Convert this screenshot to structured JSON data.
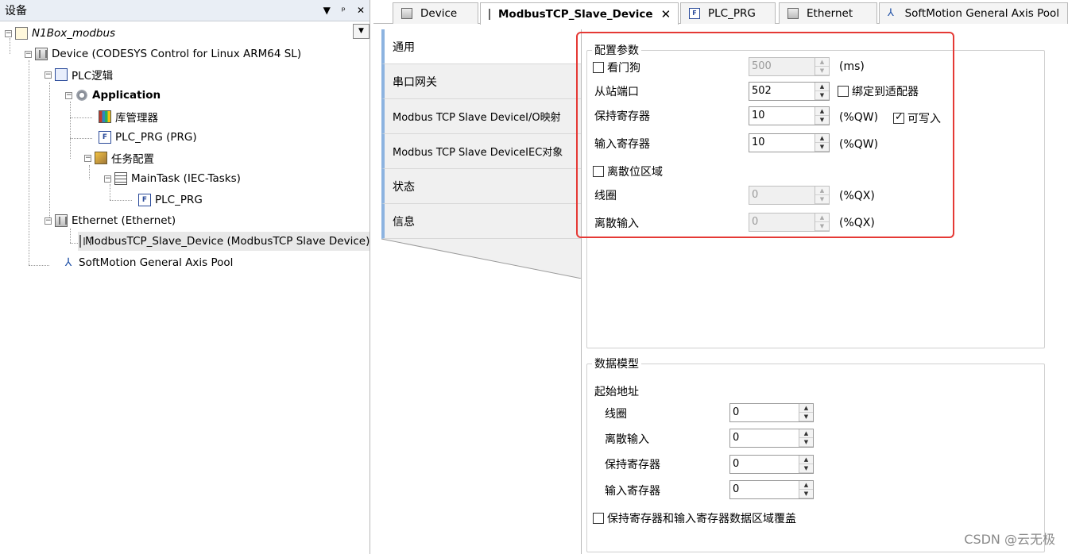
{
  "left_panel": {
    "title": "设备",
    "icons": [
      "▼",
      "ᵖ",
      "✕"
    ],
    "tree": [
      {
        "label": "N1Box_modbus",
        "icon": "project-icon"
      },
      {
        "label": "Device (CODESYS Control for Linux ARM64 SL)",
        "icon": "device-icon"
      },
      {
        "label": "PLC逻辑",
        "icon": "plc-logic-icon"
      },
      {
        "label": "Application",
        "icon": "application-gear-icon"
      },
      {
        "label": "库管理器",
        "icon": "library-manager-icon"
      },
      {
        "label": "PLC_PRG (PRG)",
        "icon": "prg-icon"
      },
      {
        "label": "任务配置",
        "icon": "task-config-icon"
      },
      {
        "label": "MainTask (IEC-Tasks)",
        "icon": "maintask-icon"
      },
      {
        "label": "PLC_PRG",
        "icon": "prg-icon"
      },
      {
        "label": "Ethernet (Ethernet)",
        "icon": "device-icon"
      },
      {
        "label": "ModbusTCP_Slave_Device (ModbusTCP Slave Device)",
        "icon": "device-icon"
      },
      {
        "label": "SoftMotion General Axis Pool",
        "icon": "axis-pool-icon"
      }
    ]
  },
  "tabs": [
    {
      "label": "Device",
      "icon": "device-icon"
    },
    {
      "label": "ModbusTCP_Slave_Device",
      "icon": "device-icon",
      "close": "✕"
    },
    {
      "label": "PLC_PRG",
      "icon": "prg-icon"
    },
    {
      "label": "Ethernet",
      "icon": "device-icon"
    },
    {
      "label": "SoftMotion General Axis Pool",
      "icon": "axis-pool-icon"
    }
  ],
  "sidenav": [
    "通用",
    "串口网关",
    "Modbus TCP Slave DeviceI/O映射",
    "Modbus TCP Slave DeviceIEC对象",
    "状态",
    "信息"
  ],
  "config": {
    "legend": "配置参数",
    "watchdog_label": "看门狗",
    "watchdog_value": "500",
    "watchdog_unit": "(ms)",
    "slave_port_label": "从站端口",
    "slave_port_value": "502",
    "bind_adapter_label": "绑定到适配器",
    "holding_label": "保持寄存器",
    "holding_value": "10",
    "holding_unit": "(%QW)",
    "writable_label": "可写入",
    "input_label": "输入寄存器",
    "input_value": "10",
    "input_unit": "(%QW)",
    "discrete_area_label": "离散位区域",
    "coils_label": "线圈",
    "coils_value": "0",
    "coils_unit": "(%QX)",
    "discrete_input_label": "离散输入",
    "discrete_input_value": "0",
    "discrete_input_unit": "(%QX)"
  },
  "data_model": {
    "legend": "数据模型",
    "start_address_label": "起始地址",
    "coils_label": "线圈",
    "coils_value": "0",
    "discrete_input_label": "离散输入",
    "discrete_input_value": "0",
    "holding_label": "保持寄存器",
    "holding_value": "0",
    "input_label": "输入寄存器",
    "input_value": "0",
    "overlay_label": "保持寄存器和输入寄存器数据区域覆盖"
  },
  "spin_arrows": {
    "up": "▲",
    "down": "▼"
  },
  "watermark": "CSDN @云无极"
}
